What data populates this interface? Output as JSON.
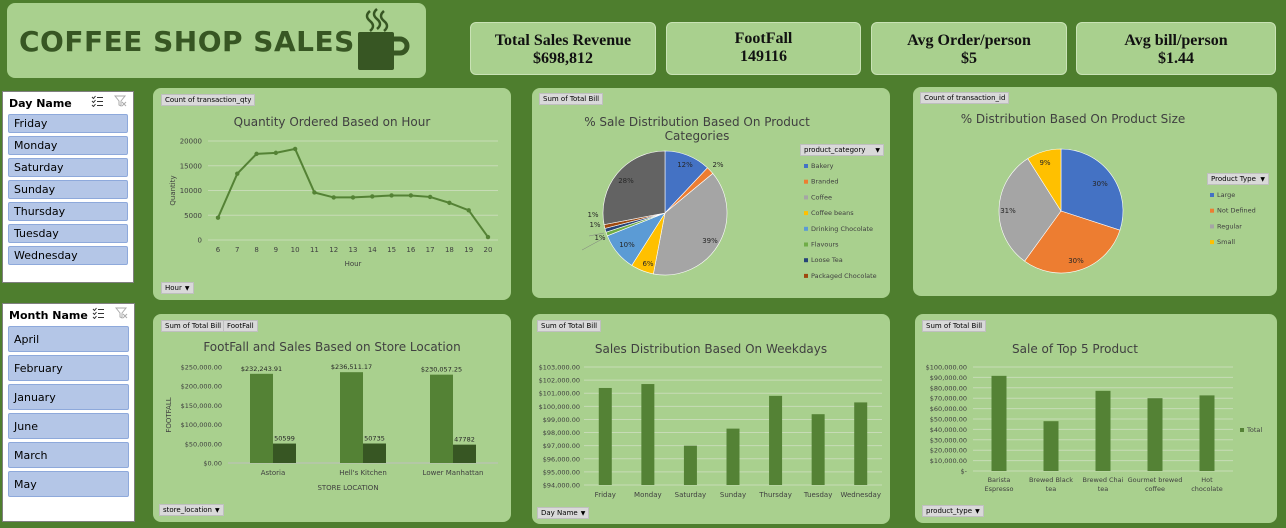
{
  "header": {
    "title": "COFFEE SHOP SALES"
  },
  "kpis": [
    {
      "label": "Total Sales Revenue",
      "value": "$698,812"
    },
    {
      "label": "FootFall",
      "value": "149116"
    },
    {
      "label": "Avg Order/person",
      "value": "$5"
    },
    {
      "label": "Avg bill/person",
      "value": "$1.44"
    }
  ],
  "day_slicer": {
    "title": "Day Name",
    "items": [
      "Friday",
      "Monday",
      "Saturday",
      "Sunday",
      "Thursday",
      "Tuesday",
      "Wednesday"
    ]
  },
  "month_slicer": {
    "title": "Month Name",
    "items": [
      "April",
      "February",
      "January",
      "June",
      "March",
      "May"
    ]
  },
  "charts": {
    "hour": {
      "value_tag": "Count of transaction_qty",
      "field_tag": "Hour"
    },
    "category": {
      "value_tag": "Sum of Total Bill",
      "legend_title": "product_category"
    },
    "size": {
      "value_tag": "Count of transaction_id",
      "legend_title": "Product Type"
    },
    "store": {
      "value_tag_1": "Sum of Total Bill",
      "value_tag_2": "FootFall",
      "field_tag": "store_location"
    },
    "weekday": {
      "value_tag": "Sum of Total Bill",
      "field_tag": "Day Name"
    },
    "top5": {
      "value_tag": "Sum of Total Bill",
      "field_tag": "product_type",
      "legend": "Total"
    }
  },
  "chart_data": [
    {
      "type": "line",
      "title": "Quantity Ordered Based on Hour",
      "xlabel": "Hour",
      "ylabel": "Quantity",
      "x": [
        6,
        7,
        8,
        9,
        10,
        11,
        12,
        13,
        14,
        15,
        16,
        17,
        18,
        19,
        20
      ],
      "series": [
        {
          "values": [
            4500,
            13400,
            17400,
            17600,
            18400,
            9600,
            8600,
            8600,
            8800,
            9000,
            9000,
            8700,
            7500,
            6000,
            600
          ]
        }
      ],
      "ylim": [
        0,
        20000
      ],
      "yticks": [
        "0",
        "5000",
        "10000",
        "15000",
        "20000"
      ]
    },
    {
      "type": "pie",
      "title": "% Sale Distribution Based On Product Categories",
      "categories": [
        "Bakery",
        "Branded",
        "Coffee",
        "Coffee beans",
        "Drinking Chocolate",
        "Flavours",
        "Loose Tea",
        "Packaged Chocolate",
        "Tea"
      ],
      "values": [
        12,
        2,
        39,
        6,
        10,
        1,
        1,
        1,
        28
      ],
      "labels": [
        "12%",
        "2%",
        "39%",
        "6%",
        "10%",
        "1%",
        "1%",
        "1%",
        "28%"
      ],
      "colors": [
        "#4472c4",
        "#ed7d31",
        "#a5a5a5",
        "#ffc000",
        "#5b9bd5",
        "#70ad47",
        "#264478",
        "#9e480e",
        "#636363"
      ]
    },
    {
      "type": "pie",
      "title": "% Distribution Based On Product Size",
      "categories": [
        "Large",
        "Not Defined",
        "Regular",
        "Small"
      ],
      "values": [
        30,
        30,
        31,
        9
      ],
      "labels": [
        "30%",
        "30%",
        "31%",
        "9%"
      ],
      "colors": [
        "#4472c4",
        "#ed7d31",
        "#a5a5a5",
        "#ffc000"
      ]
    },
    {
      "type": "bar",
      "title": "FootFall and Sales Based on Store Location",
      "xlabel": "STORE LOCATION",
      "ylabel": "FOOTFALL",
      "categories": [
        "Astoria",
        "Hell's Kitchen",
        "Lower Manhattan"
      ],
      "series": [
        {
          "name": "Sum of Total Bill",
          "values": [
            232243.91,
            236511.17,
            230057.25
          ],
          "labels": [
            "$232,243.91",
            "$236,511.17",
            "$230,057.25"
          ]
        },
        {
          "name": "FootFall",
          "values": [
            50599,
            50735,
            47782
          ],
          "labels": [
            "50599",
            "50735",
            "47782"
          ]
        }
      ],
      "ylim": [
        0,
        250000
      ],
      "yticks": [
        "$0.00",
        "$50,000.00",
        "$100,000.00",
        "$150,000.00",
        "$200,000.00",
        "$250,000.00"
      ]
    },
    {
      "type": "bar",
      "title": "Sales Distribution Based On Weekdays",
      "categories": [
        "Friday",
        "Monday",
        "Saturday",
        "Sunday",
        "Thursday",
        "Tuesday",
        "Wednesday"
      ],
      "values": [
        101400,
        101700,
        97000,
        98300,
        100800,
        99400,
        100300
      ],
      "ylim": [
        94000,
        103000
      ],
      "yticks": [
        "$94,000.00",
        "$95,000.00",
        "$96,000.00",
        "$97,000.00",
        "$98,000.00",
        "$99,000.00",
        "$100,000.00",
        "$101,000.00",
        "$102,000.00",
        "$103,000.00"
      ]
    },
    {
      "type": "bar",
      "title": "Sale of Top 5 Product",
      "categories": [
        "Barista Espresso",
        "Brewed Black tea",
        "Brewed Chai tea",
        "Gourmet brewed coffee",
        "Hot chocolate"
      ],
      "values": [
        91500,
        47900,
        77100,
        70000,
        72700
      ],
      "ylim": [
        0,
        100000
      ],
      "yticks": [
        "$-",
        "$10,000.00",
        "$20,000.00",
        "$30,000.00",
        "$40,000.00",
        "$50,000.00",
        "$60,000.00",
        "$70,000.00",
        "$80,000.00",
        "$90,000.00",
        "$100,000.00"
      ],
      "legend": "Total"
    }
  ]
}
